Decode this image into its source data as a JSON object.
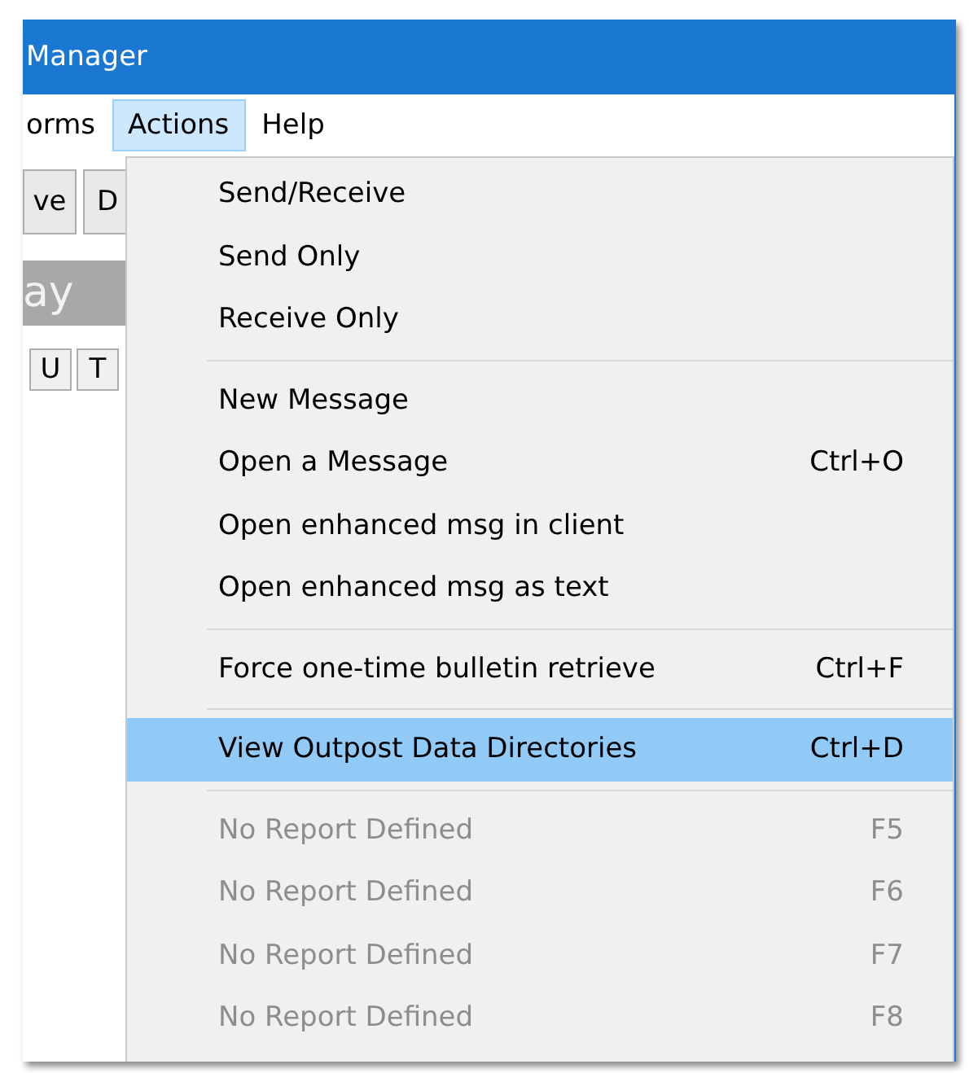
{
  "window": {
    "title": "Manager"
  },
  "menu_bar": [
    {
      "label": "orms",
      "selected": false
    },
    {
      "label": "Actions",
      "selected": true
    },
    {
      "label": "Help",
      "selected": false
    }
  ],
  "toolbar": [
    "ve",
    "D"
  ],
  "banner": "ay",
  "tab_buttons": [
    "U",
    "T"
  ],
  "menu": {
    "groups": [
      [
        {
          "label": "Send/Receive",
          "disabled": false,
          "selected": false
        },
        {
          "label": "Send Only",
          "disabled": false,
          "selected": false
        },
        {
          "label": "Receive Only",
          "disabled": false,
          "selected": false
        }
      ],
      [
        {
          "label": "New Message",
          "disabled": false,
          "selected": false
        },
        {
          "label": "Open a Message",
          "shortcut": "Ctrl+O",
          "disabled": false,
          "selected": false
        },
        {
          "label": "Open enhanced msg in client",
          "disabled": false,
          "selected": false
        },
        {
          "label": "Open enhanced msg as text",
          "disabled": false,
          "selected": false
        }
      ],
      [
        {
          "label": "Force one-time bulletin retrieve",
          "shortcut": "Ctrl+F",
          "disabled": false,
          "selected": false
        }
      ],
      [
        {
          "label": "View Outpost Data Directories",
          "shortcut": "Ctrl+D",
          "disabled": false,
          "selected": true
        }
      ],
      [
        {
          "label": "No Report Defined",
          "shortcut": "F5",
          "disabled": true,
          "selected": false
        },
        {
          "label": "No Report Defined",
          "shortcut": "F6",
          "disabled": true,
          "selected": false
        },
        {
          "label": "No Report Defined",
          "shortcut": "F7",
          "disabled": true,
          "selected": false
        },
        {
          "label": "No Report Defined",
          "shortcut": "F8",
          "disabled": true,
          "selected": false
        }
      ]
    ]
  }
}
